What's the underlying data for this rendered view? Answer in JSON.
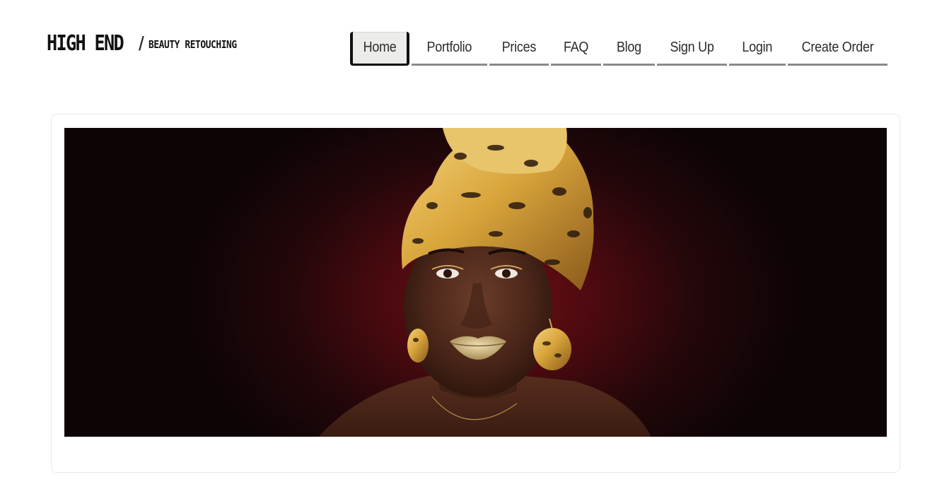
{
  "logo": {
    "main": "HIGH END",
    "slash": "/",
    "sub": "BEAUTY RETOUCHING"
  },
  "nav": {
    "items": [
      {
        "label": "Home",
        "active": true
      },
      {
        "label": "Portfolio",
        "active": false
      },
      {
        "label": "Prices",
        "active": false
      },
      {
        "label": "FAQ",
        "active": false
      },
      {
        "label": "Blog",
        "active": false
      },
      {
        "label": "Sign Up",
        "active": false
      },
      {
        "label": "Login",
        "active": false
      },
      {
        "label": "Create Order",
        "active": false
      }
    ]
  },
  "hero": {
    "image": "portrait-woman-leopard-headwrap-gold-lips"
  },
  "colors": {
    "background": "#ffffff",
    "nav_text": "#2c2c2c",
    "nav_underline": "#8a8a8a",
    "active_bg": "#ececea",
    "hero_red": "#6e0f14",
    "hero_dark": "#0c0405",
    "gold": "#d9a53b"
  }
}
